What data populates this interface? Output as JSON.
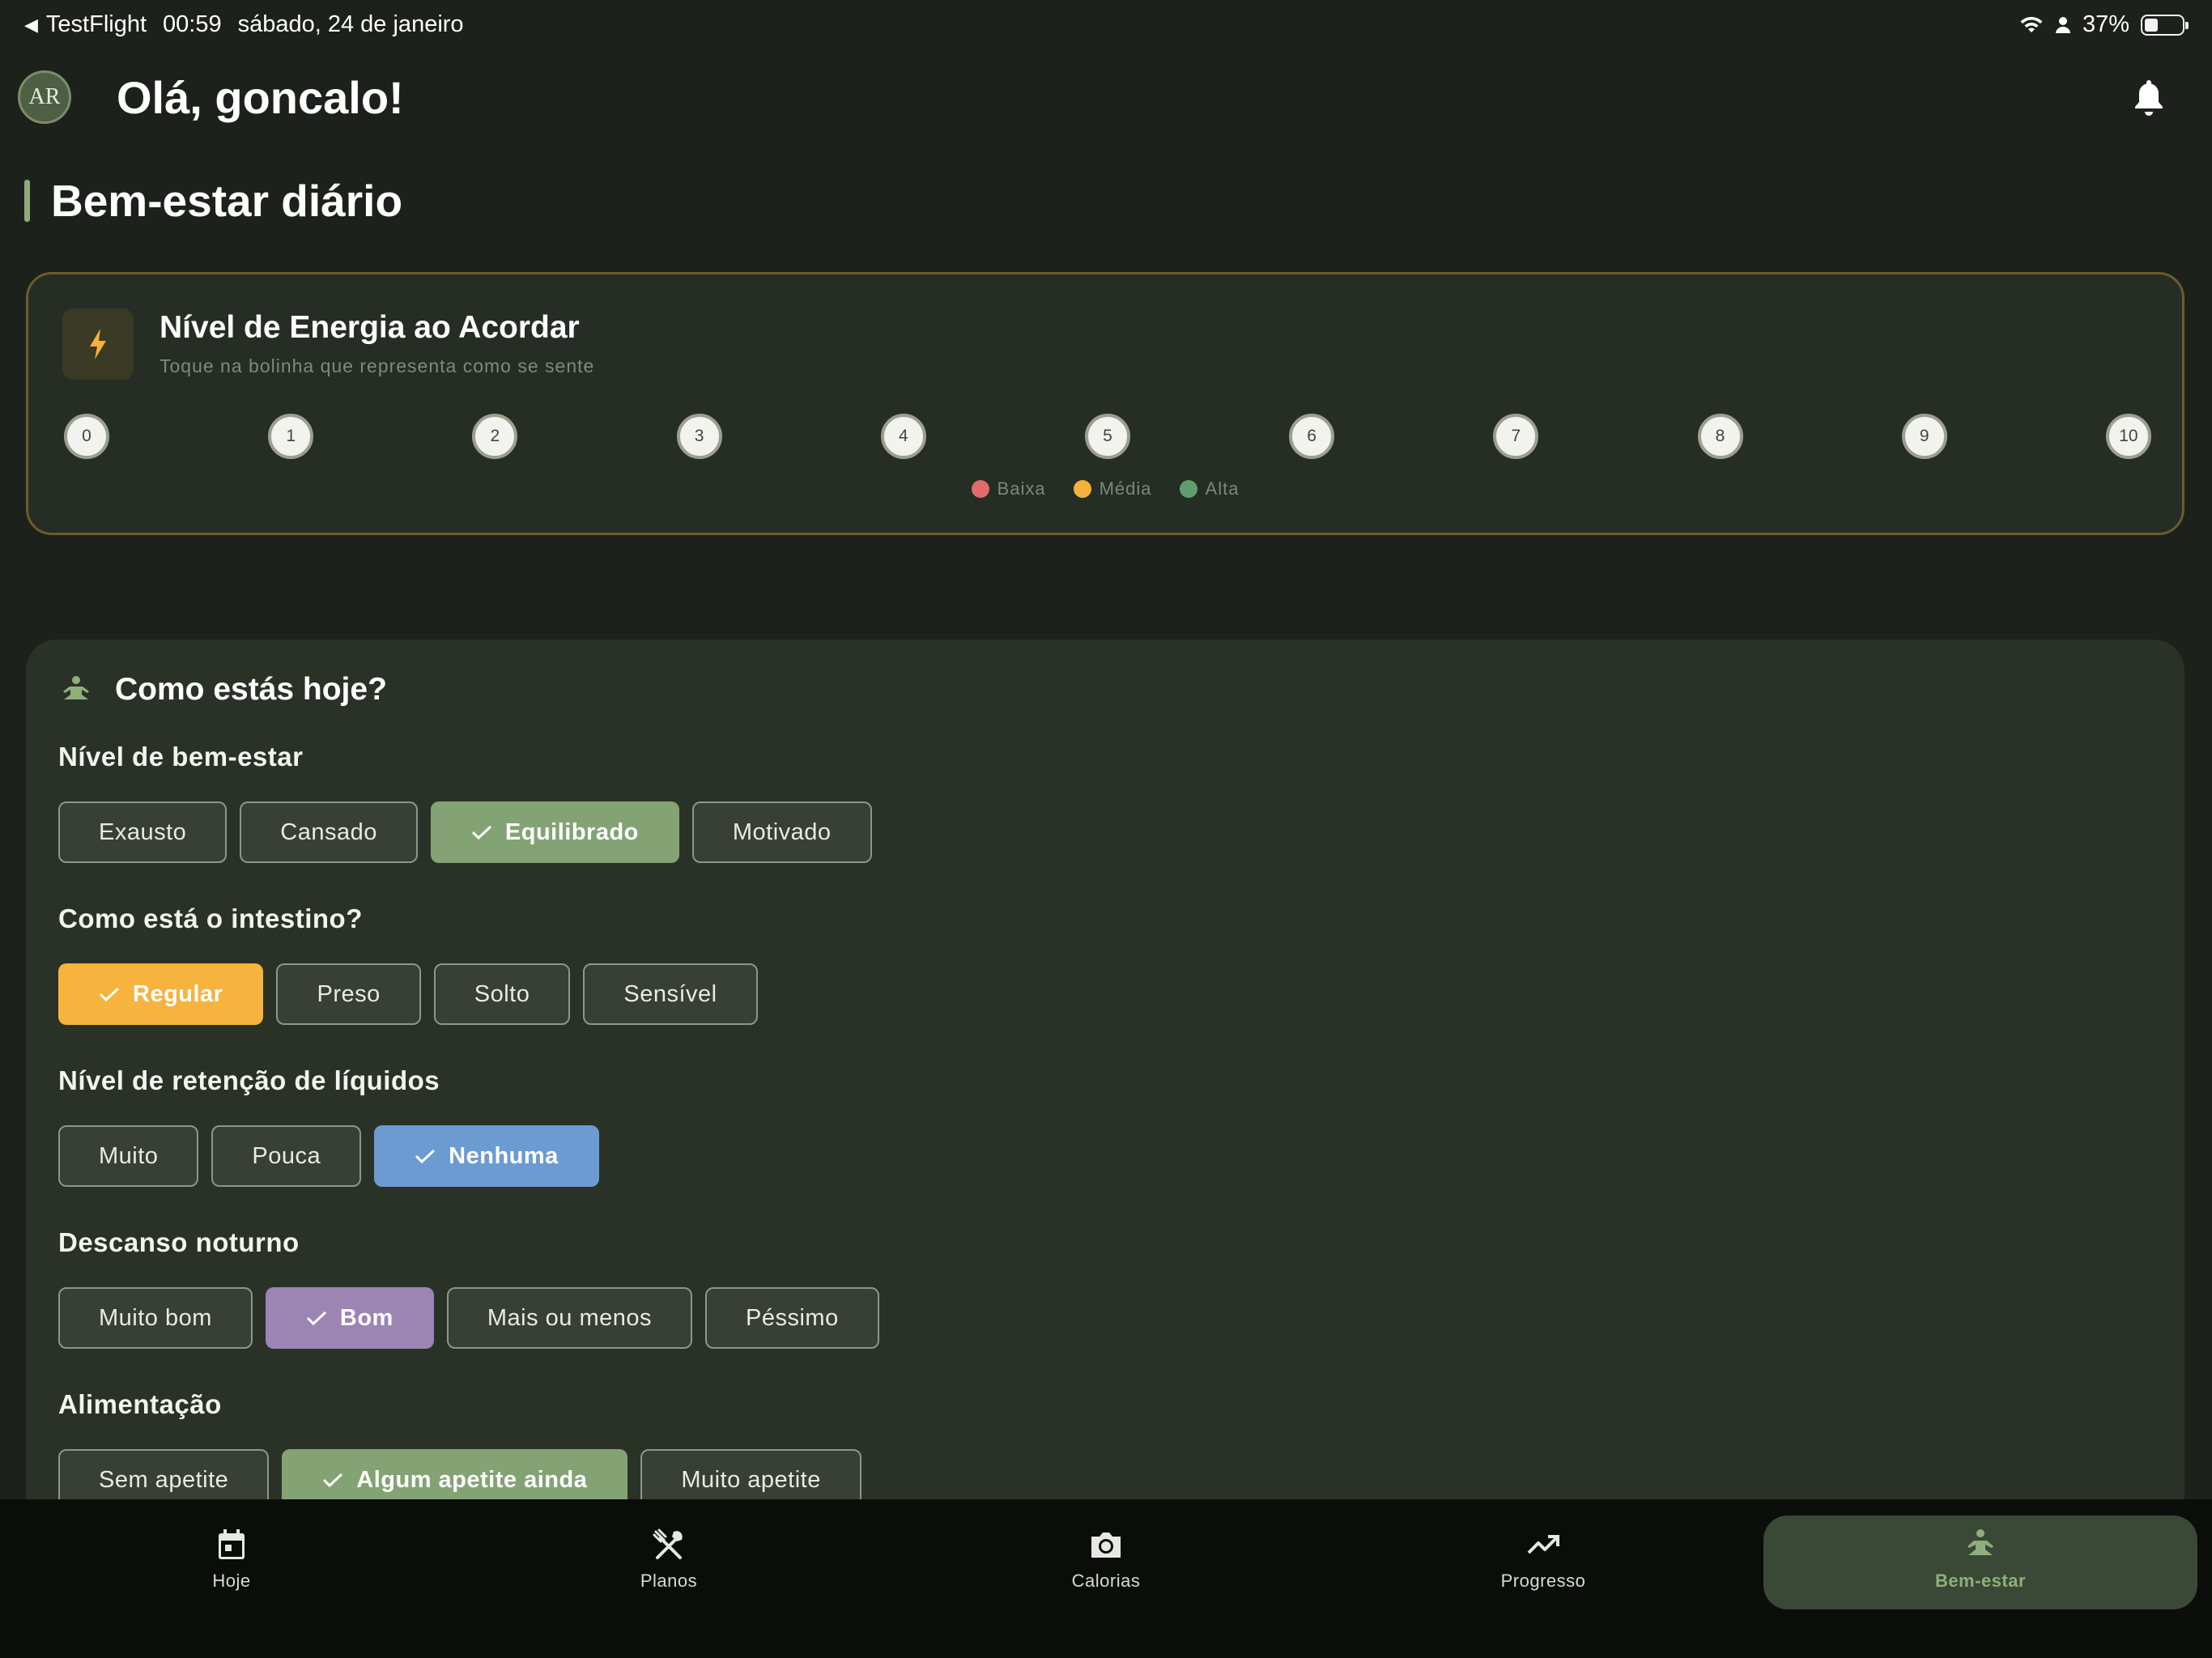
{
  "status_bar": {
    "back_app": "TestFlight",
    "time": "00:59",
    "date": "sábado, 24 de janeiro",
    "battery": "37%",
    "battery_level": 0.37
  },
  "header": {
    "avatar_text": "AR",
    "greeting": "Olá, goncalo!"
  },
  "section": {
    "title": "Bem-estar diário"
  },
  "energy": {
    "title": "Nível de Energia ao Acordar",
    "subtitle": "Toque na bolinha que representa como se sente",
    "scale": [
      "0",
      "1",
      "2",
      "3",
      "4",
      "5",
      "6",
      "7",
      "8",
      "9",
      "10"
    ],
    "legend": [
      {
        "label": "Baixa",
        "color": "#e06b6b"
      },
      {
        "label": "Média",
        "color": "#f5b13a"
      },
      {
        "label": "Alta",
        "color": "#5f9e6e"
      }
    ]
  },
  "mood": {
    "title": "Como estás hoje?",
    "groups": [
      {
        "label": "Nível de bem-estar",
        "options": [
          "Exausto",
          "Cansado",
          "Equilibrado",
          "Motivado"
        ],
        "selected": "Equilibrado",
        "selected_color": "#84a374"
      },
      {
        "label": "Como está o intestino?",
        "options": [
          "Regular",
          "Preso",
          "Solto",
          "Sensível"
        ],
        "selected": "Regular",
        "selected_color": "#f6b33e"
      },
      {
        "label": "Nível de retenção de líquidos",
        "options": [
          "Muito",
          "Pouca",
          "Nenhuma"
        ],
        "selected": "Nenhuma",
        "selected_color": "#6b9bd1"
      },
      {
        "label": "Descanso noturno",
        "options": [
          "Muito bom",
          "Bom",
          "Mais ou menos",
          "Péssimo"
        ],
        "selected": "Bom",
        "selected_color": "#9c84b3"
      },
      {
        "label": "Alimentação",
        "options": [
          "Sem apetite",
          "Algum apetite ainda",
          "Muito apetite"
        ],
        "selected": "Algum apetite ainda",
        "selected_color": "#84a374"
      }
    ]
  },
  "nav": {
    "items": [
      {
        "label": "Hoje",
        "icon": "calendar-icon"
      },
      {
        "label": "Planos",
        "icon": "utensils-icon"
      },
      {
        "label": "Calorias",
        "icon": "camera-icon"
      },
      {
        "label": "Progresso",
        "icon": "trending-up-icon"
      },
      {
        "label": "Bem-estar",
        "icon": "meditation-icon"
      }
    ],
    "active": "Bem-estar"
  }
}
